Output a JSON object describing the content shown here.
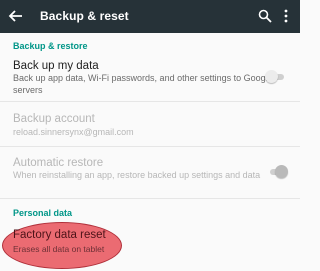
{
  "appbar": {
    "title": "Backup & reset",
    "background_color": "#263238",
    "icons": [
      "back-arrow-icon",
      "search-icon",
      "more-vert-icon"
    ]
  },
  "sections": {
    "backup_restore": "Backup & restore",
    "personal_data": "Personal data"
  },
  "items": {
    "back_up": {
      "title": "Back up my data",
      "subtitle": "Back up app data, Wi-Fi passwords, and other settings to Google servers",
      "toggle": "off"
    },
    "backup_account": {
      "title": "Backup account",
      "subtitle": "reload.sinnersynx@gmail.com"
    },
    "auto_restore": {
      "title": "Automatic restore",
      "subtitle": "When reinstalling an app, restore backed up settings and data",
      "toggle": "on-disabled"
    },
    "factory_reset": {
      "title": "Factory data reset",
      "subtitle": "Erases all data on tablet"
    }
  },
  "colors": {
    "accent": "#009688",
    "highlight": "#e84c54"
  }
}
